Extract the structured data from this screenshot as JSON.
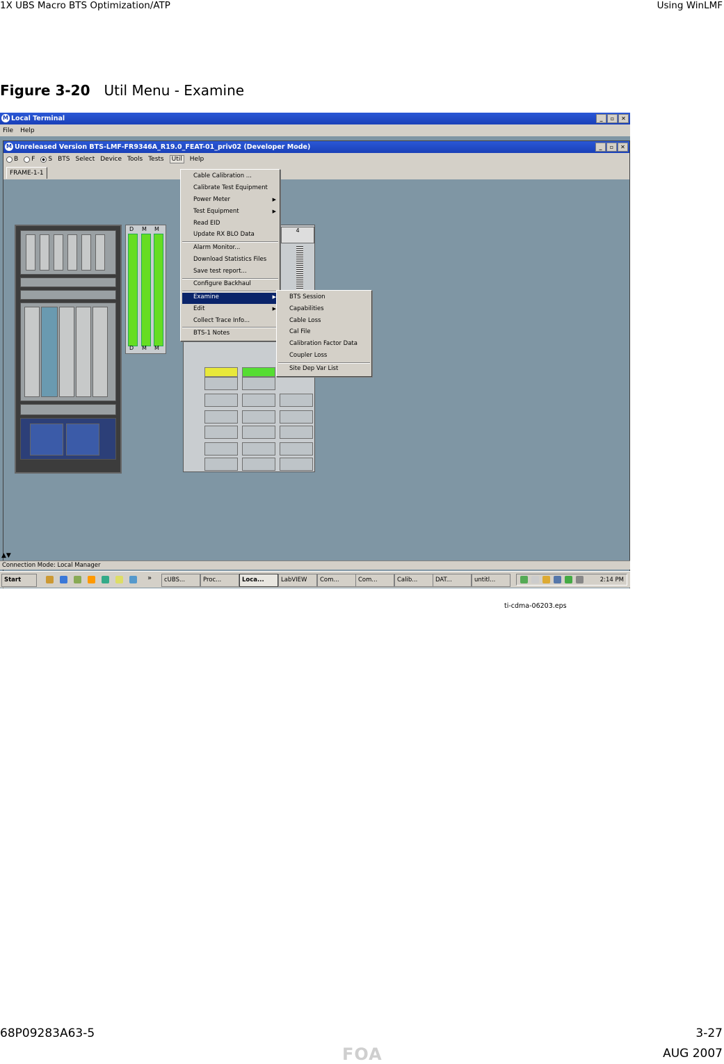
{
  "page": {
    "header_left": "1X UBS Macro BTS Optimization/ATP",
    "header_right": "Using WinLMF",
    "figure_label": "Figure 3-20",
    "figure_title": "Util Menu - Examine",
    "image_id": "ti-cdma-06203.eps",
    "footer_left": "68P09283A63-5",
    "footer_right": "3-27",
    "footer_center": "FOA",
    "footer_date": "AUG 2007"
  },
  "app": {
    "title": "Local Terminal",
    "menu": [
      "File",
      "Help"
    ],
    "inner_title": "Unreleased Version BTS-LMF-FR9346A_R19.0_FEAT-01_priv02 (Developer Mode)",
    "radios": [
      "B",
      "F",
      "S"
    ],
    "inner_menu": [
      "BTS",
      "Select",
      "Device",
      "Tools",
      "Tests",
      "Util",
      "Help"
    ],
    "tab": "FRAME-1-1",
    "card_labels_top": [
      "D",
      "M",
      "M"
    ],
    "card_labels_bottom": [
      "D",
      "M",
      "M"
    ],
    "panel_header": "4"
  },
  "util_menu": {
    "items": [
      "Cable Calibration ...",
      "Calibrate Test Equipment",
      "Power Meter",
      "Test Equipment",
      "Read EID",
      "Update RX BLO Data",
      "Alarm Monitor...",
      "Download Statistics Files",
      "Save test report...",
      "Configure Backhaul",
      "Examine",
      "Edit",
      "Collect Trace Info...",
      "BTS-1 Notes"
    ]
  },
  "examine_menu": {
    "items": [
      "BTS Session",
      "Capabilities",
      "Cable Loss",
      "Cal File",
      "Calibration Factor Data",
      "Coupler Loss",
      "Site Dep Var List"
    ]
  },
  "status": {
    "text": "Connection Mode: Local Manager"
  },
  "taskbar": {
    "start": "Start",
    "more": "»",
    "buttons": [
      "cUBS...",
      "Proc...",
      "Loca...",
      "LabVIEW",
      "Com...",
      "Com...",
      "Calib...",
      "DAT...",
      "untitl..."
    ],
    "clock": "2:14 PM"
  }
}
